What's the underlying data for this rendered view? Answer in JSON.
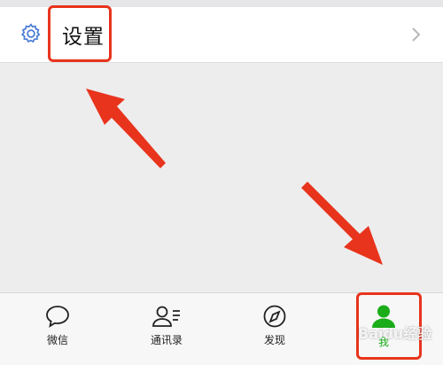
{
  "settings_row": {
    "label": "设置",
    "icon": "gear-icon",
    "chevron": "chevron-right-icon"
  },
  "tabbar": {
    "tabs": [
      {
        "label": "微信",
        "icon": "chat-bubble-icon"
      },
      {
        "label": "通讯录",
        "icon": "contacts-icon"
      },
      {
        "label": "发现",
        "icon": "compass-icon"
      },
      {
        "label": "我",
        "icon": "person-icon",
        "active": true
      }
    ]
  },
  "watermark": {
    "text": "Baidu经验"
  },
  "colors": {
    "accent_blue": "#576b95",
    "active_green": "#1aad19",
    "annotation_red": "#e8341c"
  }
}
